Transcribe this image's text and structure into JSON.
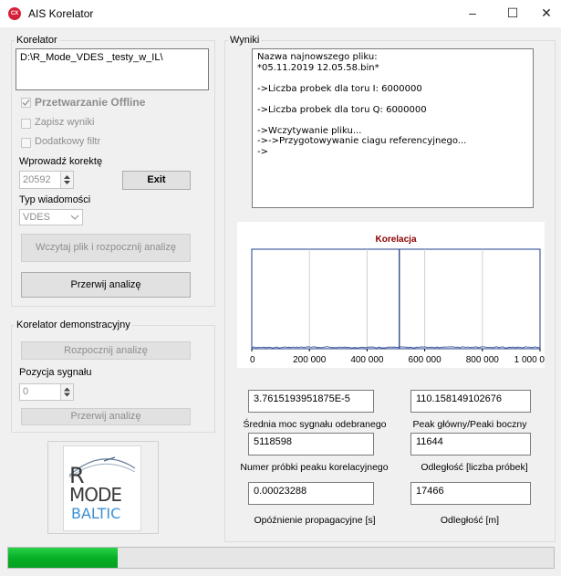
{
  "window": {
    "title": "AIS Korelator",
    "icon_text": "CX",
    "minimize": "–",
    "maximize": "☐",
    "close": "✕"
  },
  "korelator": {
    "group_label": "Korelator",
    "path": "D:\\R_Mode_VDES _testy_w_IL\\",
    "offline_label": "Przetwarzanie Offline",
    "offline_checked": true,
    "save_label": "Zapisz wyniki",
    "filter_label": "Dodatkowy filtr",
    "correction_label": "Wprowadź korektę",
    "correction_value": "20592",
    "exit_label": "Exit",
    "message_type_label": "Typ wiadomości",
    "message_type_value": "VDES",
    "load_button": "Wczytaj plik i rozpocznij analizę",
    "stop_button": "Przerwij analizę"
  },
  "demo": {
    "group_label": "Korelator demonstracyjny",
    "start_button": "Rozpocznij analizę",
    "position_label": "Pozycja sygnału",
    "position_value": "0",
    "stop_button": "Przerwij analizę"
  },
  "logo": {
    "line1": "R",
    "line2": "MODE",
    "line3": "BALTIC"
  },
  "wyniki": {
    "group_label": "Wyniki",
    "log": "Nazwa najnowszego pliku:\n*05.11.2019 12.05.58.bin*\n\n->Liczba probek dla toru I: 6000000\n\n->Liczba probek dla toru Q: 6000000\n\n->Wczytywanie pliku...\n->->Przygotowywanie ciagu referencyjnego...\n->",
    "results": [
      {
        "value": "3.7615193951875E-5",
        "label": "Średnia moc sygnału odebranego"
      },
      {
        "value": "110.158149102676",
        "label": "Peak główny/Peaki boczny"
      },
      {
        "value": "5118598",
        "label": "Numer próbki peaku korelacyjnego"
      },
      {
        "value": "11644",
        "label": "Odległość [liczba próbek]"
      },
      {
        "value": "0.00023288",
        "label": "Opóźnienie propagacyjne [s]"
      },
      {
        "value": "17466",
        "label": "Odległość [m]"
      }
    ]
  },
  "progress": {
    "fraction": 0.2,
    "color": "#06b025"
  },
  "chart_data": {
    "type": "line",
    "title": "Korelacja",
    "xlim": [
      0,
      1000000
    ],
    "ylim": [
      0,
      1
    ],
    "x_ticks": [
      "0",
      "200 000",
      "400 000",
      "600 000",
      "800 000",
      "1 000 0"
    ],
    "x_tick_values": [
      0,
      200000,
      400000,
      600000,
      800000,
      1000000
    ],
    "noise_level": 0.02,
    "series": [
      {
        "color": "#1f3d8a",
        "peak_x": 511860,
        "peak_y": 1.0
      }
    ],
    "grid": true,
    "title_color": "#8b0000"
  }
}
